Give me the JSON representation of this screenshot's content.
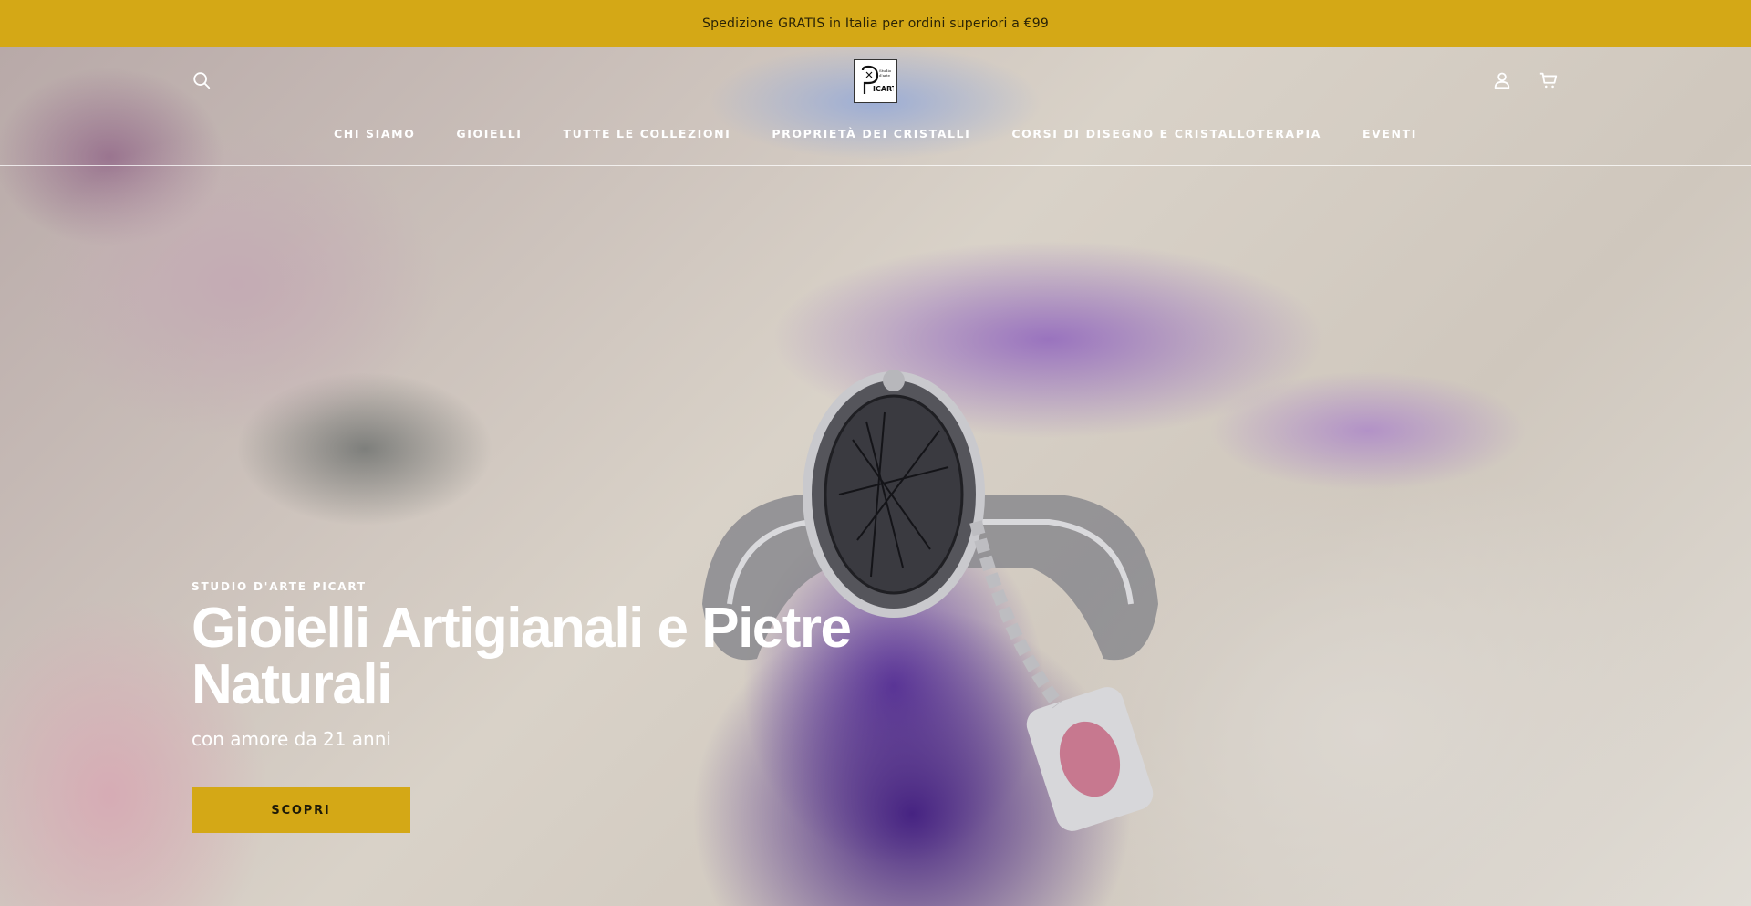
{
  "announcement": {
    "text": "Spedizione GRATIS in Italia per ordini superiori a €99"
  },
  "header": {
    "logo_alt": "PICART",
    "nav": [
      {
        "label": "CHI SIAMO"
      },
      {
        "label": "GIOIELLI"
      },
      {
        "label": "TUTTE LE COLLEZIONI"
      },
      {
        "label": "PROPRIETÀ DEI CRISTALLI"
      },
      {
        "label": "CORSI DI DISEGNO E CRISTALLOTERAPIA"
      },
      {
        "label": "EVENTI"
      }
    ],
    "icons": {
      "search": "search-icon",
      "account": "user-icon",
      "cart": "cart-icon"
    }
  },
  "hero": {
    "eyebrow": "STUDIO D'ARTE PICART",
    "headline": "Gioielli Artigianali e Pietre Naturali",
    "subline": "con amore da 21 anni",
    "cta_label": "SCOPRI"
  },
  "colors": {
    "accent": "#d4a816",
    "text_on_hero": "#ffffff"
  }
}
